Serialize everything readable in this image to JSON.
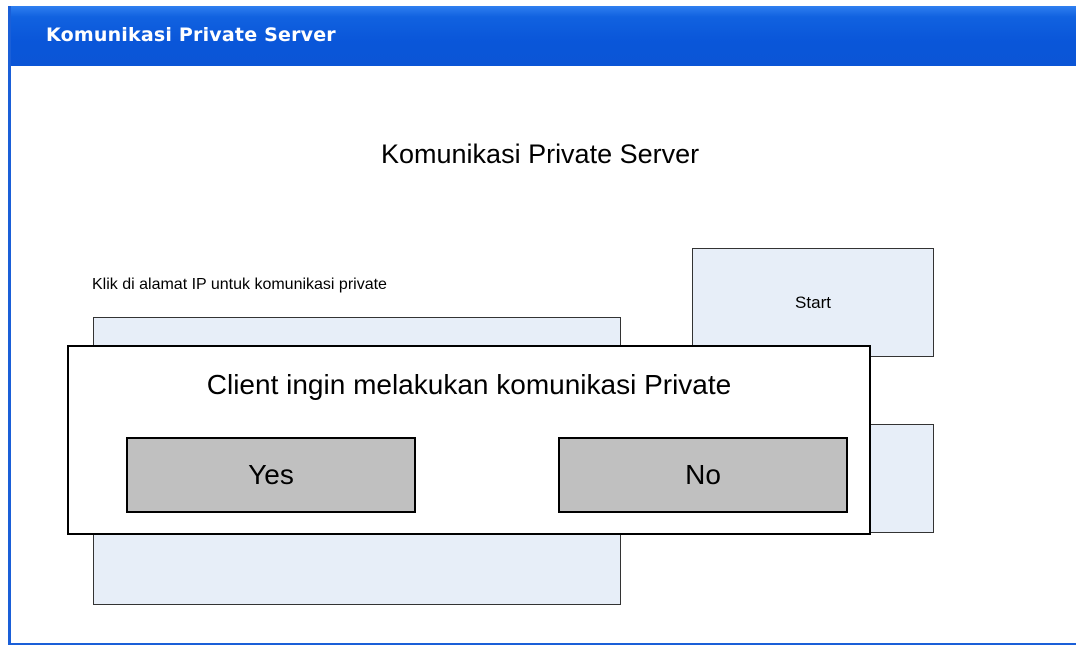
{
  "window": {
    "title": "Komunikasi Private Server"
  },
  "main": {
    "heading": "Komunikasi Private Server",
    "ip_label": "Klik di alamat IP untuk komunikasi private",
    "start_label": "Start"
  },
  "dialog": {
    "message": "Client ingin melakukan komunikasi Private",
    "yes_label": "Yes",
    "no_label": "No"
  },
  "colors": {
    "titlebar": "#0b55d6",
    "panel_fill": "#e7eef8",
    "dialog_button": "#c0c0c0"
  }
}
